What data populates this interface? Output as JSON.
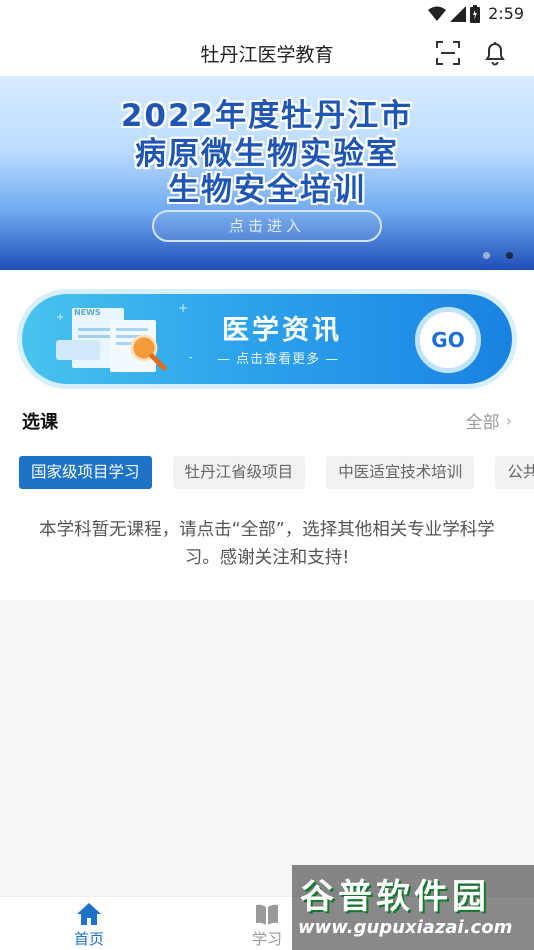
{
  "status": {
    "time": "2:59"
  },
  "app": {
    "title": "牡丹江医学教育"
  },
  "banner": {
    "lines": [
      "2022年度牡丹江市",
      "病原微生物实验室",
      "生物安全培训"
    ],
    "button": "点击进入",
    "active_dot": 2,
    "dot_count": 2
  },
  "news_card": {
    "title": "医学资讯",
    "subtitle": "— 点击查看更多 —",
    "go": "GO",
    "tag": "NEWS"
  },
  "section": {
    "title": "选课",
    "all": "全部"
  },
  "chips": [
    "国家级项目学习",
    "牡丹江省级项目",
    "中医适宜技术培训",
    "公共"
  ],
  "empty_message": "本学科暂无课程，请点击“全部”，选择其他相关专业学科学习。感谢关注和支持!",
  "nav": [
    {
      "label": "首页",
      "icon": "home-icon",
      "active": true
    },
    {
      "label": "学习",
      "icon": "book-icon",
      "active": false
    }
  ],
  "watermark": {
    "name": "谷普软件园",
    "url": "www.gupuxiazai.com"
  },
  "colors": {
    "accent": "#1e73c9",
    "banner_text": "#1f56b3"
  }
}
